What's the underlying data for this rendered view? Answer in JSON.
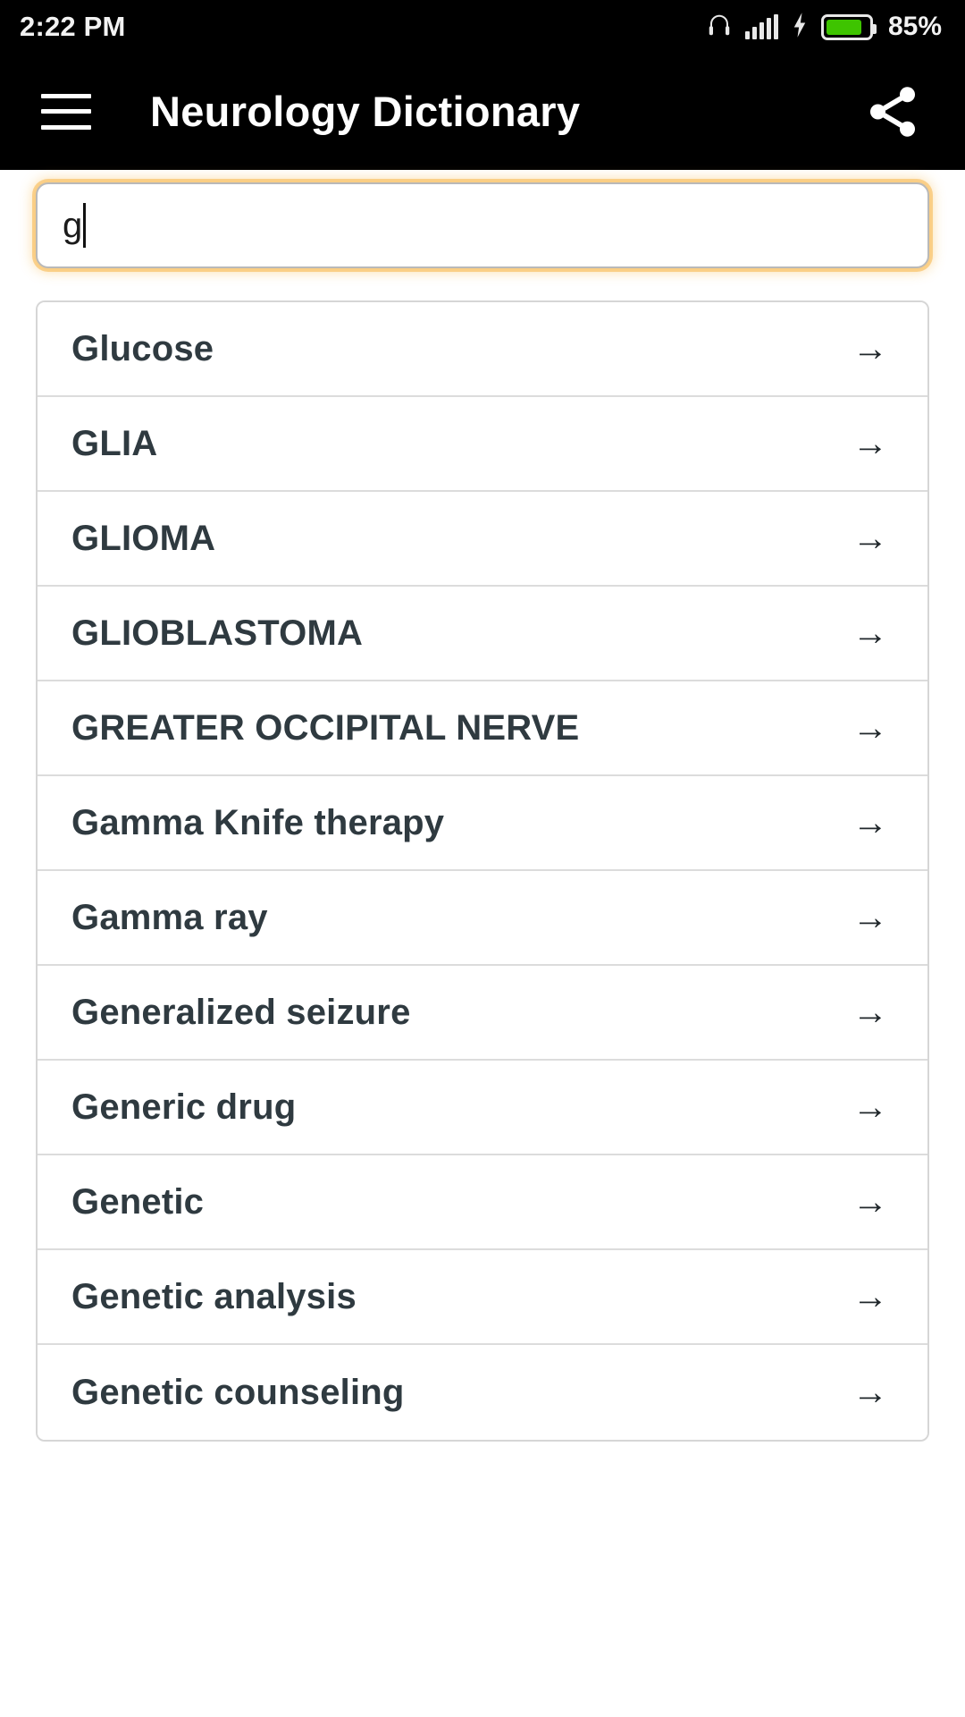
{
  "statusbar": {
    "time": "2:22 PM",
    "battery_percent": "85%",
    "icons": {
      "headphones": "headphones-icon",
      "signal": "signal-bars-icon",
      "charging": "charging-bolt-icon",
      "battery": "battery-icon"
    },
    "battery_fill_percent": 85,
    "battery_color": "#3ec400"
  },
  "appbar": {
    "menu_icon": "hamburger-menu-icon",
    "title": "Neurology Dictionary",
    "share_icon": "share-icon",
    "background": "#000000"
  },
  "search": {
    "value": "g",
    "placeholder": "",
    "focus_ring_color": "#f7b74a"
  },
  "list": {
    "arrow_glyph": "→",
    "items": [
      {
        "label": "Glucose"
      },
      {
        "label": "GLIA"
      },
      {
        "label": "GLIOMA"
      },
      {
        "label": "GLIOBLASTOMA"
      },
      {
        "label": "GREATER OCCIPITAL NERVE"
      },
      {
        "label": "Gamma Knife therapy"
      },
      {
        "label": "Gamma ray"
      },
      {
        "label": "Generalized seizure"
      },
      {
        "label": "Generic drug"
      },
      {
        "label": "Genetic"
      },
      {
        "label": "Genetic analysis"
      },
      {
        "label": "Genetic counseling"
      }
    ]
  }
}
